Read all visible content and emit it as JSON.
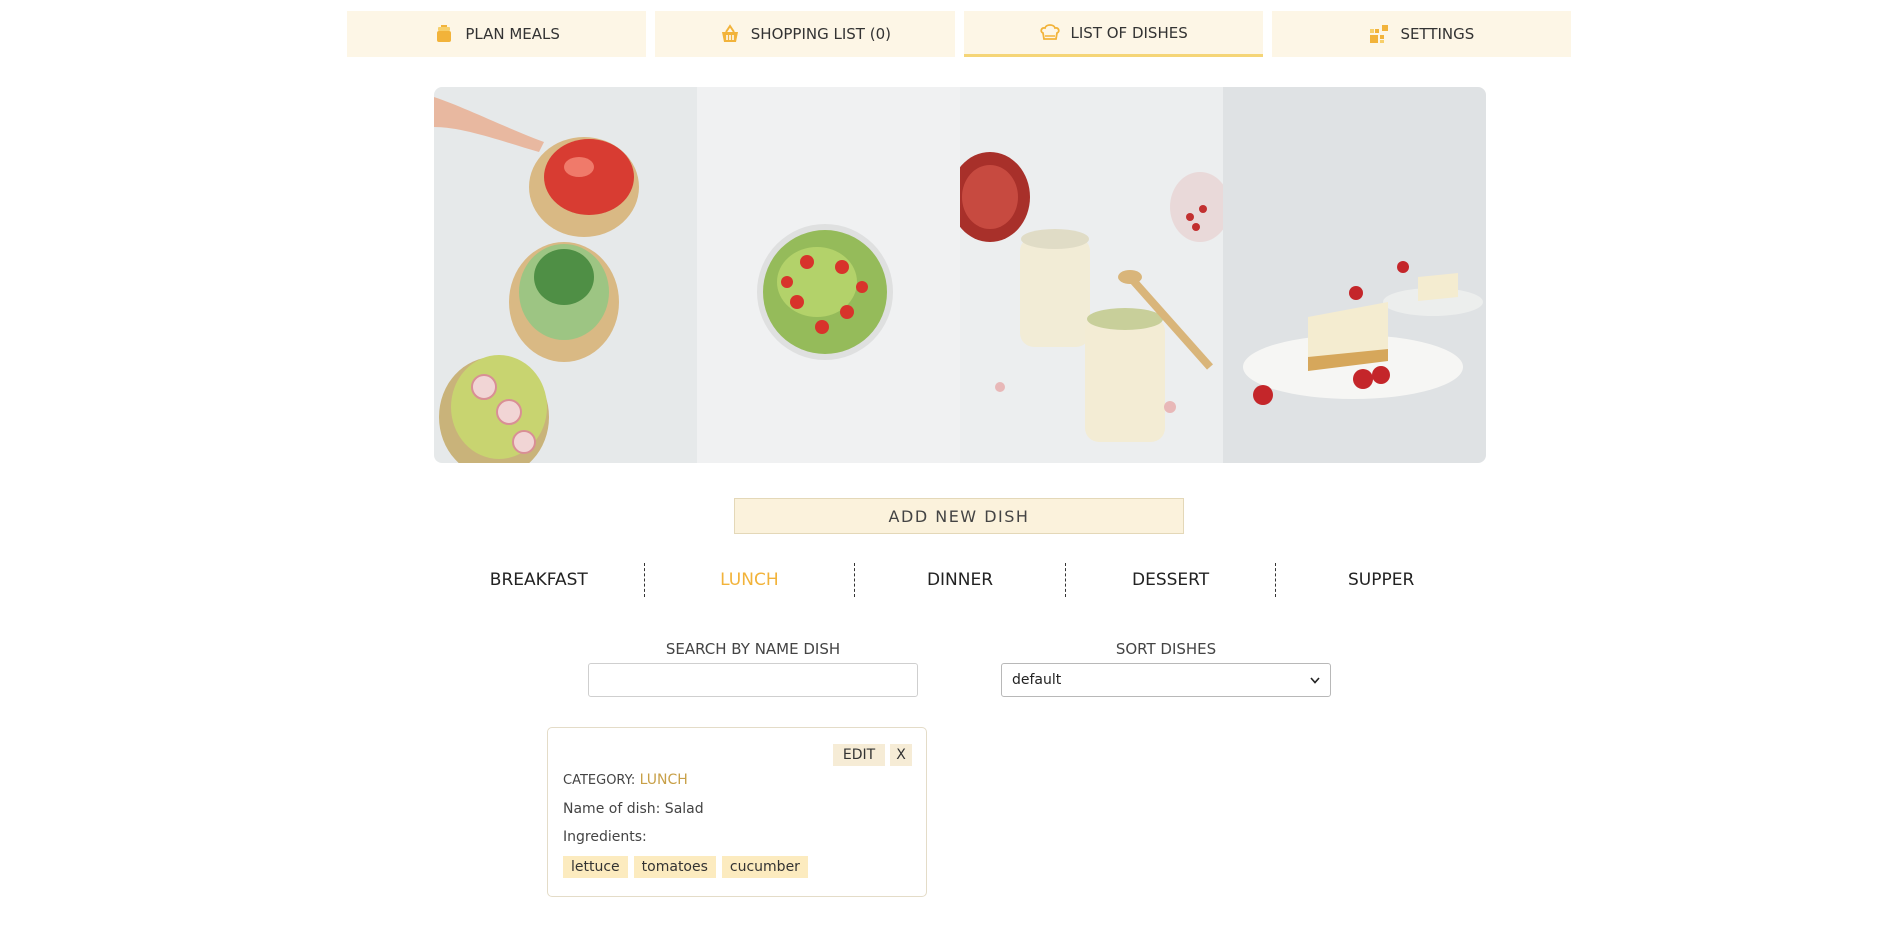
{
  "nav": {
    "tabs": [
      {
        "label": "PLAN MEALS",
        "icon": "bowl-icon"
      },
      {
        "label": "SHOPPING LIST (0)",
        "icon": "basket-icon"
      },
      {
        "label": "LIST OF DISHES",
        "icon": "chef-hat-icon",
        "active": true
      },
      {
        "label": "SETTINGS",
        "icon": "settings-icon"
      }
    ]
  },
  "hero": {
    "images": [
      "bruschetta-photo",
      "salad-bowl-photo",
      "yogurt-jars-photo",
      "cheesecake-photo"
    ]
  },
  "add_button": "ADD NEW DISH",
  "categories": {
    "items": [
      "BREAKFAST",
      "LUNCH",
      "DINNER",
      "DESSERT",
      "SUPPER"
    ],
    "active": "LUNCH"
  },
  "search": {
    "label": "SEARCH BY NAME DISH",
    "value": ""
  },
  "sort": {
    "label": "SORT DISHES",
    "value": "default"
  },
  "dish": {
    "edit_label": "EDIT",
    "close_label": "X",
    "category_label": "CATEGORY:",
    "category_value": "LUNCH",
    "name_line": "Name of dish: Salad",
    "ingredients_label": "Ingredients:",
    "ingredients": [
      "lettuce",
      "tomatoes",
      "cucumber"
    ]
  },
  "colors": {
    "accent": "#f2b33a",
    "tab_bg": "#fdf6e6",
    "chip_bg": "#fcebbf",
    "active_underline": "#f5d577"
  }
}
